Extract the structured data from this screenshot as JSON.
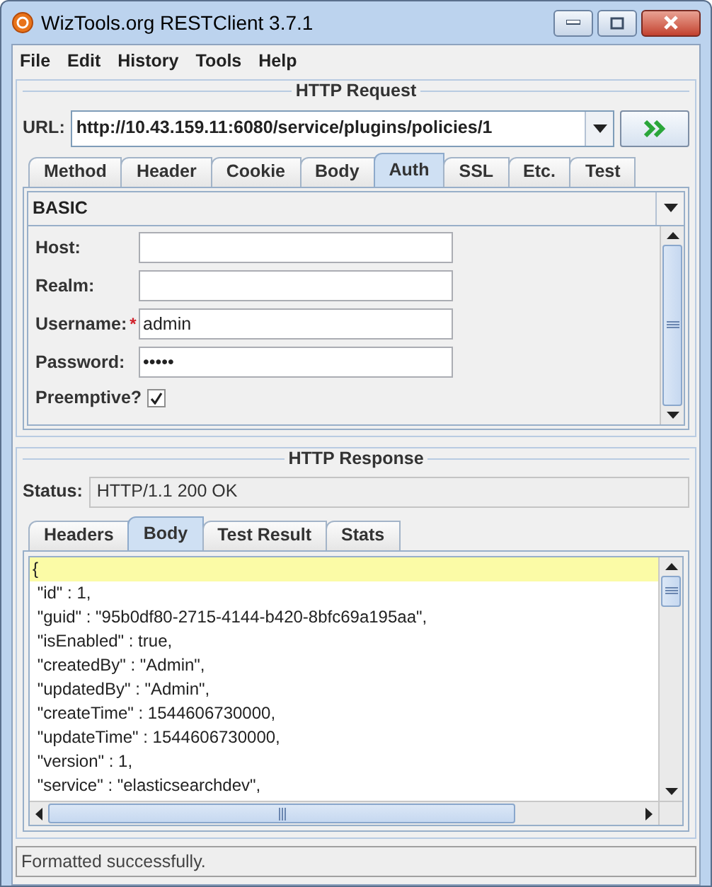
{
  "window": {
    "title": "WizTools.org RESTClient 3.7.1"
  },
  "menu": [
    {
      "label": "File"
    },
    {
      "label": "Edit"
    },
    {
      "label": "History"
    },
    {
      "label": "Tools"
    },
    {
      "label": "Help"
    }
  ],
  "request": {
    "title": "HTTP Request",
    "url_label": "URL:",
    "url": "http://10.43.159.11:6080/service/plugins/policies/1",
    "tabs": [
      {
        "label": "Method",
        "selected": false
      },
      {
        "label": "Header",
        "selected": false
      },
      {
        "label": "Cookie",
        "selected": false
      },
      {
        "label": "Body",
        "selected": false
      },
      {
        "label": "Auth",
        "selected": true
      },
      {
        "label": "SSL",
        "selected": false
      },
      {
        "label": "Etc.",
        "selected": false
      },
      {
        "label": "Test",
        "selected": false
      }
    ],
    "auth_type": "BASIC",
    "fields": [
      {
        "label": "Host:",
        "required": false
      },
      {
        "label": "Realm:",
        "required": false
      },
      {
        "label": "Username:",
        "required": true,
        "marker": "*",
        "value": "admin"
      },
      {
        "label": "Password:",
        "required": false,
        "value": "•••••"
      }
    ],
    "preemptive": {
      "label": "Preemptive?",
      "checked": true
    }
  },
  "response": {
    "title": "HTTP Response",
    "status_label": "Status:",
    "status": "HTTP/1.1 200 OK",
    "tabs": [
      {
        "label": "Headers",
        "selected": false
      },
      {
        "label": "Body",
        "selected": true
      },
      {
        "label": "Test Result",
        "selected": false
      },
      {
        "label": "Stats",
        "selected": false
      }
    ],
    "body_lines": [
      {
        "text": "{",
        "highlighted": true
      },
      {
        "text": "\"id\" : 1,",
        "highlighted": false
      },
      {
        "text": "\"guid\" : \"95b0df80-2715-4144-b420-8bfc69a195aa\",",
        "highlighted": false
      },
      {
        "text": "\"isEnabled\" : true,",
        "highlighted": false
      },
      {
        "text": "\"createdBy\" : \"Admin\",",
        "highlighted": false
      },
      {
        "text": "\"updatedBy\" : \"Admin\",",
        "highlighted": false
      },
      {
        "text": "\"createTime\" : 1544606730000,",
        "highlighted": false
      },
      {
        "text": "\"updateTime\" : 1544606730000,",
        "highlighted": false
      },
      {
        "text": "\"version\" : 1,",
        "highlighted": false
      },
      {
        "text": "\"service\" : \"elasticsearchdev\",",
        "highlighted": false
      }
    ]
  },
  "status_bar": "Formatted successfully."
}
